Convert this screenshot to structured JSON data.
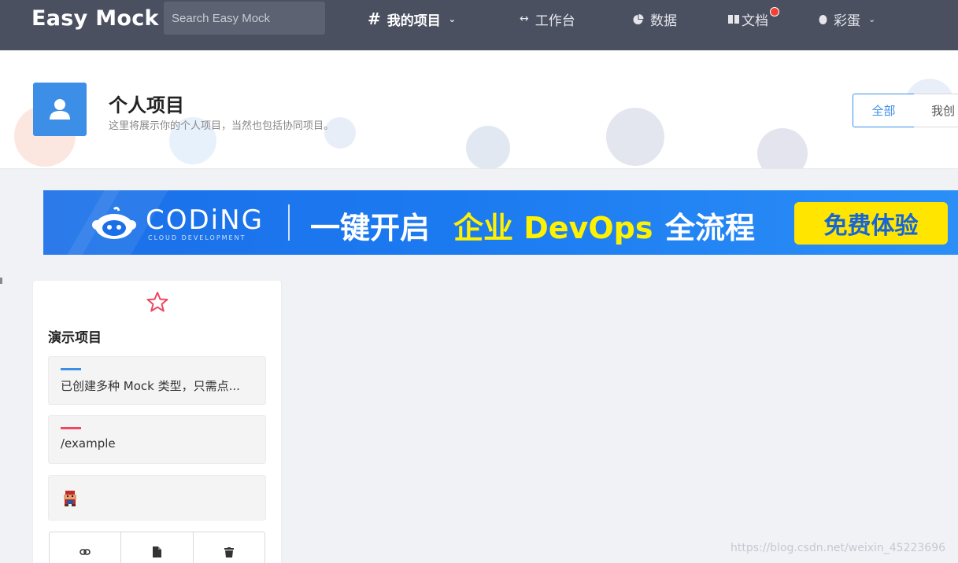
{
  "app": {
    "logo": "Easy Mock"
  },
  "search": {
    "placeholder": "Search Easy Mock"
  },
  "nav": {
    "my_projects": "我的项目",
    "workbench": "工作台",
    "data": "数据",
    "docs": "文档",
    "easter_egg": "彩蛋"
  },
  "header": {
    "title": "个人项目",
    "subtitle": "这里将展示你的个人项目，当然也包括协同项目。",
    "filter_all": "全部",
    "filter_mine": "我创"
  },
  "banner": {
    "brand": "CODiNG",
    "brand_sub": "CLOUD DEVELOPMENT",
    "text1": "一键开启",
    "text2": "企业 DevOps",
    "text3": "全流程",
    "cta": "免费体验"
  },
  "card": {
    "title": "演示项目",
    "description": "已创建多种 Mock 类型，只需点...",
    "url": "/example",
    "description_bar_color": "#3d8ee6",
    "url_bar_color": "#f04864"
  },
  "watermark": "https://blog.csdn.net/weixin_45223696",
  "colors": {
    "nav_bg": "#4b5061",
    "accent": "#3d8ee6",
    "star": "#f04864"
  }
}
